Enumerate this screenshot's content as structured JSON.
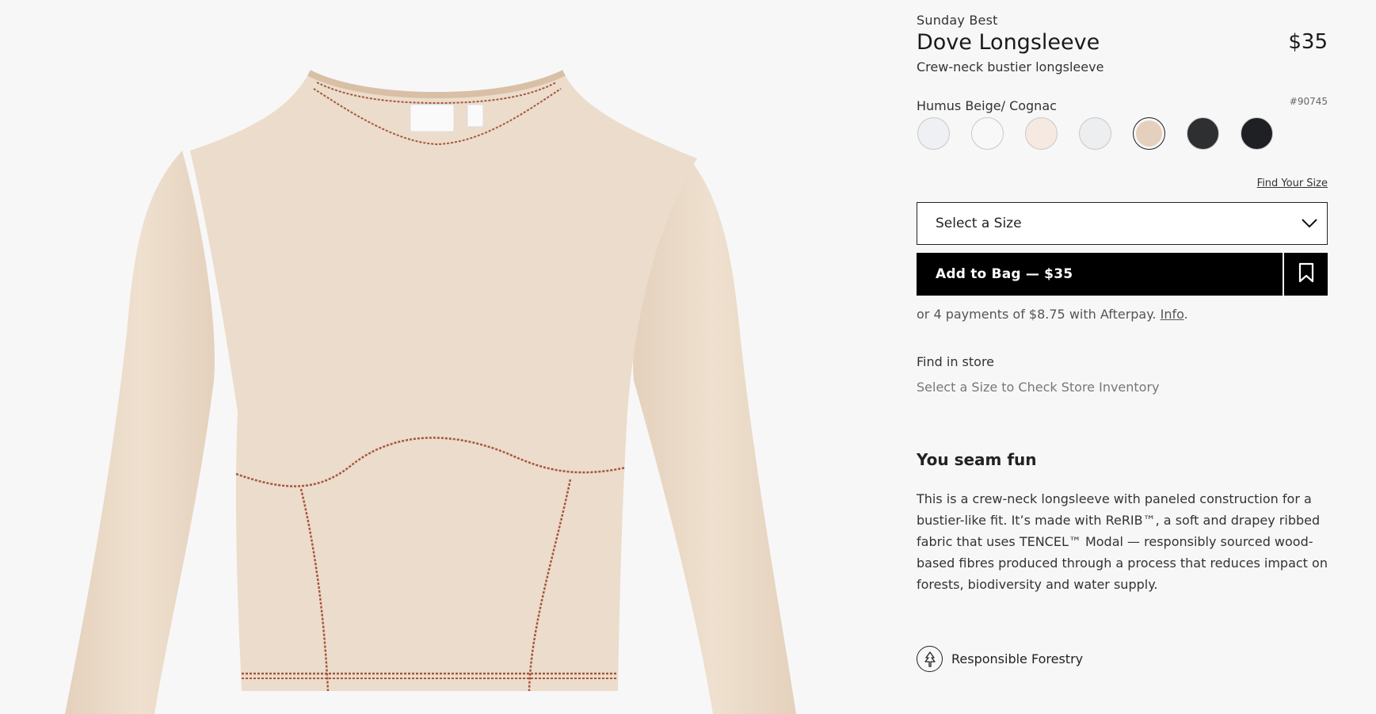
{
  "product": {
    "brand": "Sunday Best",
    "title": "Dove Longsleeve",
    "price": "$35",
    "subtitle": "Crew-neck bustier longsleeve",
    "color_name": "Humus Beige/ Cognac",
    "style_number": "#90745"
  },
  "swatches": [
    {
      "name": "white-swatch-1",
      "color": "#eef0f3"
    },
    {
      "name": "white-swatch-2",
      "color": "#f8f8f8"
    },
    {
      "name": "blush-swatch",
      "color": "#f6e9e1"
    },
    {
      "name": "light-grey-swatch",
      "color": "#eceef0"
    },
    {
      "name": "humus-beige-swatch",
      "color": "#e4d0bc",
      "selected": true
    },
    {
      "name": "charcoal-swatch",
      "color": "#2e2f31"
    },
    {
      "name": "black-swatch",
      "color": "#1e2024"
    }
  ],
  "size": {
    "find_link": "Find Your Size",
    "select_placeholder": "Select a Size"
  },
  "cart": {
    "add_label": "Add to Bag — $35"
  },
  "afterpay": {
    "text": "or 4 payments of $8.75 with Afterpay.",
    "link": "Info",
    "suffix": "."
  },
  "store": {
    "heading": "Find in store",
    "hint": "Select a Size to Check Store Inventory"
  },
  "description": {
    "heading": "You seam fun",
    "body": "This is a crew-neck longsleeve with paneled construction for a bustier-like fit. It’s made with ReRIB™, a soft and drapey ribbed fabric that uses TENCEL™ Modal — responsibly sourced wood-based fibres produced through a process that reduces impact on forests, biodiversity and water supply."
  },
  "feature": {
    "label": "Responsible Forestry",
    "icon": "tree-icon"
  },
  "colors": {
    "garment": "#ecdccb",
    "stitch": "#a5573e",
    "button_bg": "#000000"
  }
}
